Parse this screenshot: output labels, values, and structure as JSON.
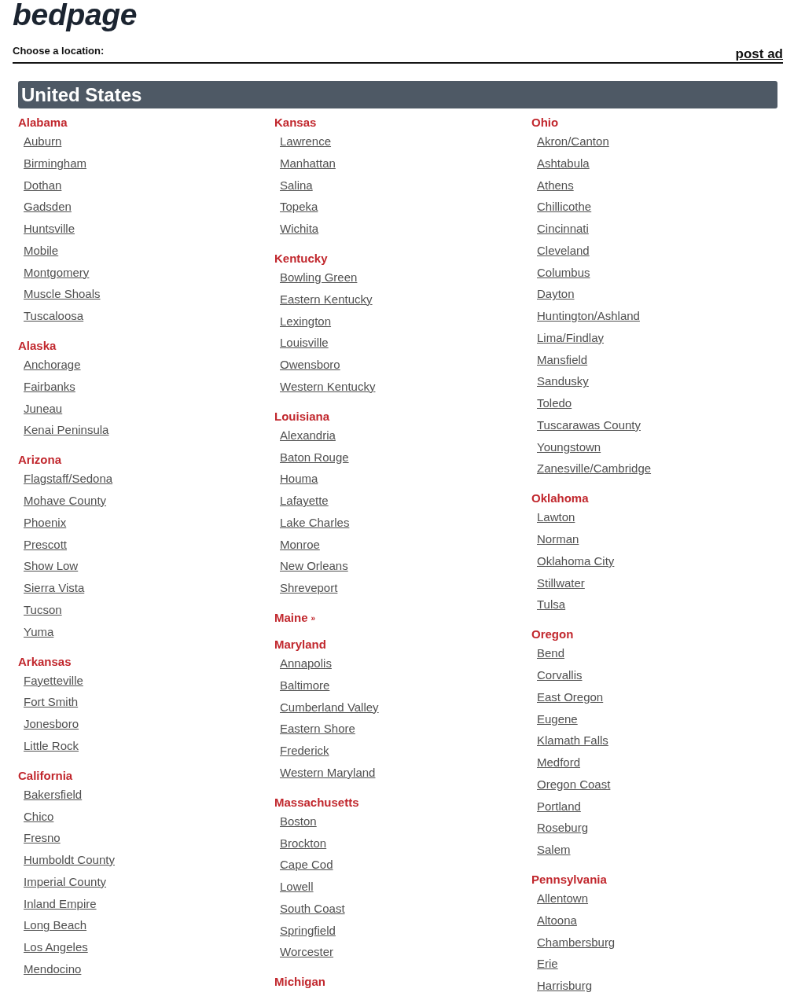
{
  "header": {
    "logo": "bedpage",
    "prompt": "Choose a location:",
    "post_ad": "post ad"
  },
  "region": {
    "title": "United States",
    "columns": [
      {
        "states": [
          {
            "name": "Alabama",
            "cities": [
              "Auburn",
              "Birmingham",
              "Dothan",
              "Gadsden",
              "Huntsville",
              "Mobile",
              "Montgomery",
              "Muscle Shoals",
              "Tuscaloosa"
            ]
          },
          {
            "name": "Alaska",
            "cities": [
              "Anchorage",
              "Fairbanks",
              "Juneau",
              "Kenai Peninsula"
            ]
          },
          {
            "name": "Arizona",
            "cities": [
              "Flagstaff/Sedona",
              "Mohave County",
              "Phoenix",
              "Prescott",
              "Show Low",
              "Sierra Vista",
              "Tucson",
              "Yuma"
            ]
          },
          {
            "name": "Arkansas",
            "cities": [
              "Fayetteville",
              "Fort Smith",
              "Jonesboro",
              "Little Rock"
            ]
          },
          {
            "name": "California",
            "cities": [
              "Bakersfield",
              "Chico",
              "Fresno",
              "Humboldt County",
              "Imperial County",
              "Inland Empire",
              "Long Beach",
              "Los Angeles",
              "Mendocino"
            ]
          }
        ]
      },
      {
        "states": [
          {
            "name": "Kansas",
            "cities": [
              "Lawrence",
              "Manhattan",
              "Salina",
              "Topeka",
              "Wichita"
            ]
          },
          {
            "name": "Kentucky",
            "cities": [
              "Bowling Green",
              "Eastern Kentucky",
              "Lexington",
              "Louisville",
              "Owensboro",
              "Western Kentucky"
            ]
          },
          {
            "name": "Louisiana",
            "cities": [
              "Alexandria",
              "Baton Rouge",
              "Houma",
              "Lafayette",
              "Lake Charles",
              "Monroe",
              "New Orleans",
              "Shreveport"
            ]
          },
          {
            "name": "Maine",
            "arrow": "»"
          },
          {
            "name": "Maryland",
            "cities": [
              "Annapolis",
              "Baltimore",
              "Cumberland Valley",
              "Eastern Shore",
              "Frederick",
              "Western Maryland"
            ]
          },
          {
            "name": "Massachusetts",
            "cities": [
              "Boston",
              "Brockton",
              "Cape Cod",
              "Lowell",
              "South Coast",
              "Springfield",
              "Worcester"
            ]
          },
          {
            "name": "Michigan"
          }
        ]
      },
      {
        "states": [
          {
            "name": "Ohio",
            "cities": [
              "Akron/Canton",
              "Ashtabula",
              "Athens",
              "Chillicothe",
              "Cincinnati",
              "Cleveland",
              "Columbus",
              "Dayton",
              "Huntington/Ashland",
              "Lima/Findlay",
              "Mansfield",
              "Sandusky",
              "Toledo",
              "Tuscarawas County",
              "Youngstown",
              "Zanesville/Cambridge"
            ]
          },
          {
            "name": "Oklahoma",
            "cities": [
              "Lawton",
              "Norman",
              "Oklahoma City",
              "Stillwater",
              "Tulsa"
            ]
          },
          {
            "name": "Oregon",
            "cities": [
              "Bend",
              "Corvallis",
              "East Oregon",
              "Eugene",
              "Klamath Falls",
              "Medford",
              "Oregon Coast",
              "Portland",
              "Roseburg",
              "Salem"
            ]
          },
          {
            "name": "Pennsylvania",
            "cities": [
              "Allentown",
              "Altoona",
              "Chambersburg",
              "Erie",
              "Harrisburg"
            ]
          }
        ]
      }
    ]
  }
}
